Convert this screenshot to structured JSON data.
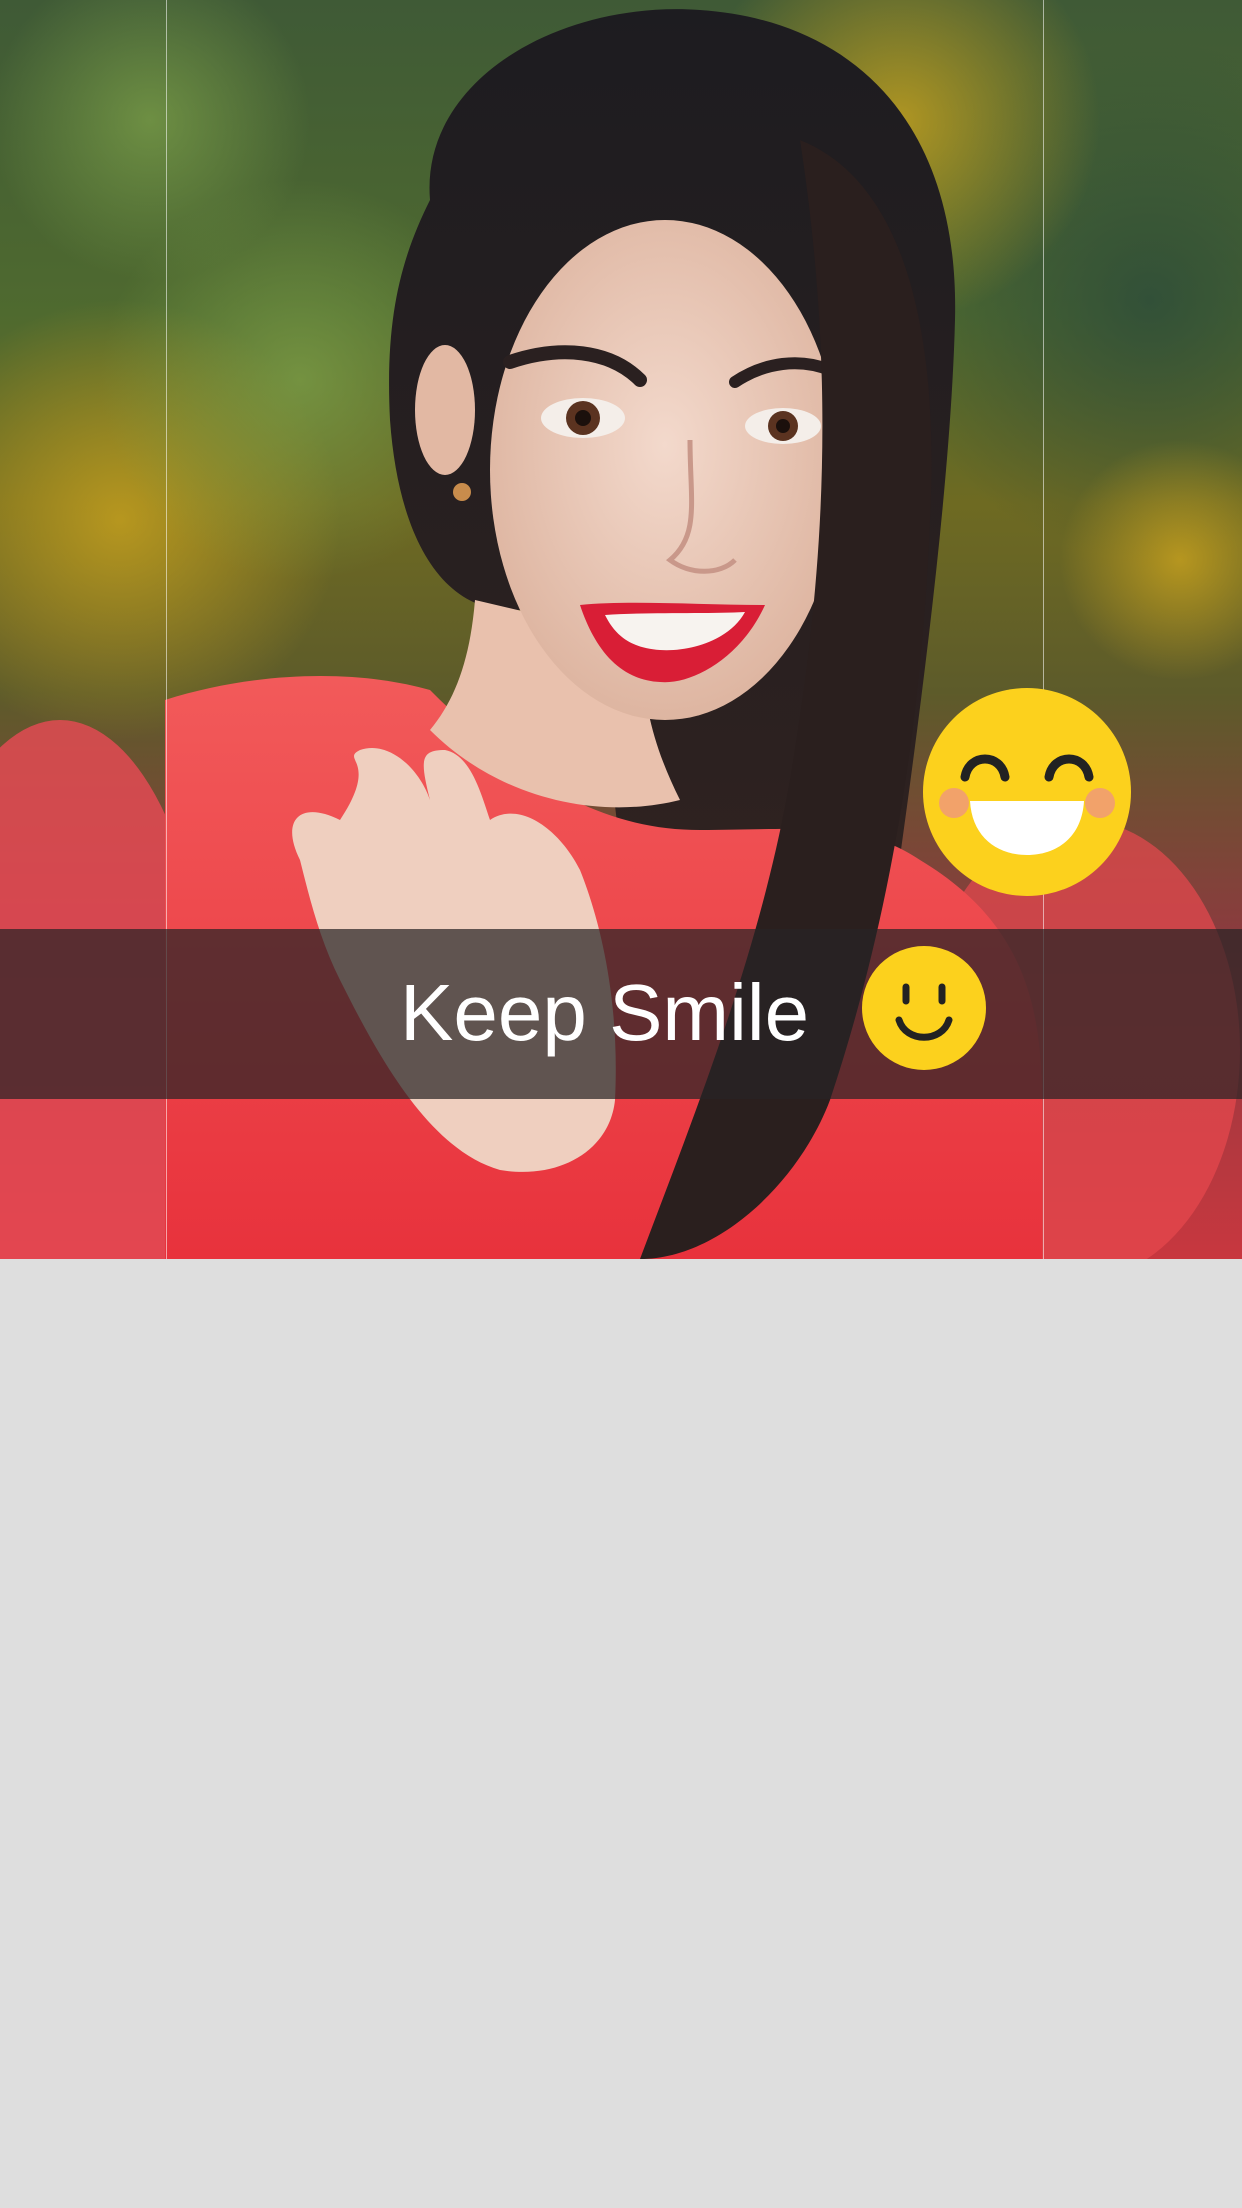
{
  "caption": {
    "text": "Keep Smile"
  },
  "stickers": {
    "big": "laughing-emoji-icon",
    "small": "smile-emoji-icon"
  },
  "colors": {
    "emoji_yellow": "#fcd11d",
    "caption_bar": "#282426",
    "canvas": "#dedede",
    "sweater": "#ef3b44",
    "lips": "#d91e36"
  }
}
